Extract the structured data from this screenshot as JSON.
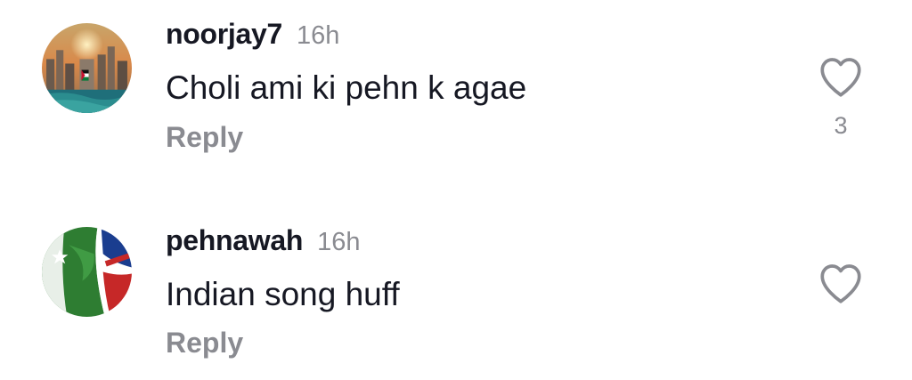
{
  "comments": [
    {
      "username": "noorjay7",
      "time": "16h",
      "text": "Choli ami ki pehn k agae",
      "reply_label": "Reply",
      "like_count": "3",
      "avatar_icon": "cityscape-flag-avatar",
      "like_icon": "heart-outline-icon"
    },
    {
      "username": "pehnawah",
      "time": "16h",
      "text": "Indian song huff",
      "reply_label": "Reply",
      "like_count": "",
      "avatar_icon": "flags-avatar",
      "like_icon": "heart-outline-icon"
    }
  ],
  "colors": {
    "primary_text": "#161823",
    "secondary_text": "#8a8b91",
    "background": "#ffffff"
  }
}
